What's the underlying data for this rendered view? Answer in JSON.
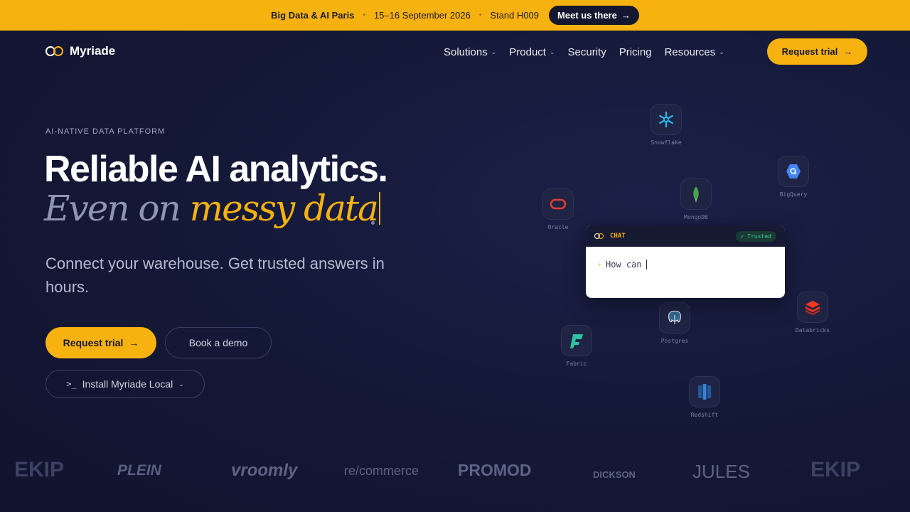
{
  "banner": {
    "event": "Big Data & AI Paris",
    "dates": "15–16 September 2026",
    "stand": "Stand H009",
    "cta": "Meet us there"
  },
  "nav": {
    "brand": "Myriade",
    "items": [
      {
        "label": "Solutions",
        "has_dropdown": true
      },
      {
        "label": "Product",
        "has_dropdown": true
      },
      {
        "label": "Security",
        "has_dropdown": false
      },
      {
        "label": "Pricing",
        "has_dropdown": false
      },
      {
        "label": "Resources",
        "has_dropdown": true
      }
    ],
    "cta": "Request trial"
  },
  "hero": {
    "eyebrow": "AI-NATIVE DATA PLATFORM",
    "headline": "Reliable AI analytics.",
    "tagline_muted": "Even on",
    "tagline_accent": "messy data",
    "subtitle": "Connect your warehouse. Get trusted answers in hours.",
    "primary_cta": "Request trial",
    "secondary_cta": "Book a demo",
    "local_cta": "Install Myriade Local"
  },
  "integrations": [
    {
      "name": "Snowflake",
      "icon": "snowflake-icon"
    },
    {
      "name": "BigQuery",
      "icon": "bigquery-icon"
    },
    {
      "name": "MongoDB",
      "icon": "mongodb-icon"
    },
    {
      "name": "Oracle",
      "icon": "oracle-icon"
    },
    {
      "name": "Postgres",
      "icon": "postgres-icon"
    },
    {
      "name": "Databricks",
      "icon": "databricks-icon"
    },
    {
      "name": "Fabric",
      "icon": "fabric-icon"
    },
    {
      "name": "Redshift",
      "icon": "redshift-icon"
    }
  ],
  "chat": {
    "title": "CHAT",
    "badge": "✓ Trusted",
    "input_text": "How can"
  },
  "customers": [
    "EKIP",
    "PLEIN",
    "vroomly",
    "re/commerce",
    "PROMOD",
    "DICKSON",
    "JULES",
    "EKIP"
  ],
  "colors": {
    "accent": "#f8b20f",
    "background": "#15193a",
    "trusted_green": "#3ed39b"
  }
}
